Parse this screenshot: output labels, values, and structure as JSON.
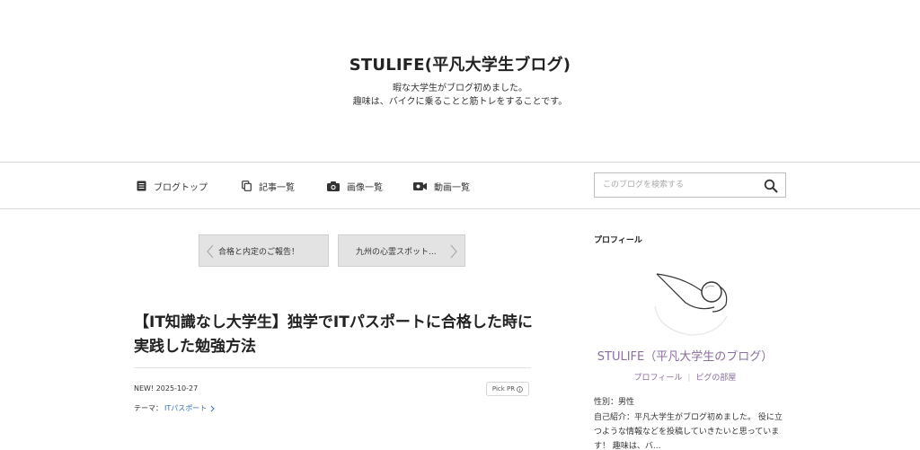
{
  "header": {
    "title": "STULIFE(平凡大学生ブログ)",
    "description_line1": "暇な大学生がブログ初めました。",
    "description_line2": "趣味は、バイクに乗ることと筋トレをすることです。"
  },
  "nav": {
    "items": [
      {
        "label": "ブログトップ",
        "icon": "document-icon"
      },
      {
        "label": "記事一覧",
        "icon": "copy-icon"
      },
      {
        "label": "画像一覧",
        "icon": "camera-icon"
      },
      {
        "label": "動画一覧",
        "icon": "video-icon"
      }
    ],
    "search_placeholder": "このブログを検索する"
  },
  "pager": {
    "prev_label": "合格と内定のご報告！",
    "next_label": "九州の心霊スポット..."
  },
  "article": {
    "title": "【IT知識なし大学生】独学でITパスポートに合格した時に実践した勉強方法",
    "date": "NEW!  2025-10-27",
    "pick_pr": "Pick PR",
    "theme_label": "テーマ：",
    "theme_link": "ITパスポート"
  },
  "sidebar": {
    "heading": "プロフィール",
    "name": "STULIFE（平凡大学生のブログ）",
    "link_profile": "プロフィール",
    "link_room": "ピグの部屋",
    "gender": "性別：男性",
    "bio": "自己紹介：平凡大学生がブログ初めました。 役に立つような情報などを投稿していきたいと思っています！ 趣味は、バ..."
  },
  "colors": {
    "accent_link": "#3a6fb0",
    "profile_purple": "#8a6e9c",
    "pager_bg": "#e3e3e3"
  }
}
